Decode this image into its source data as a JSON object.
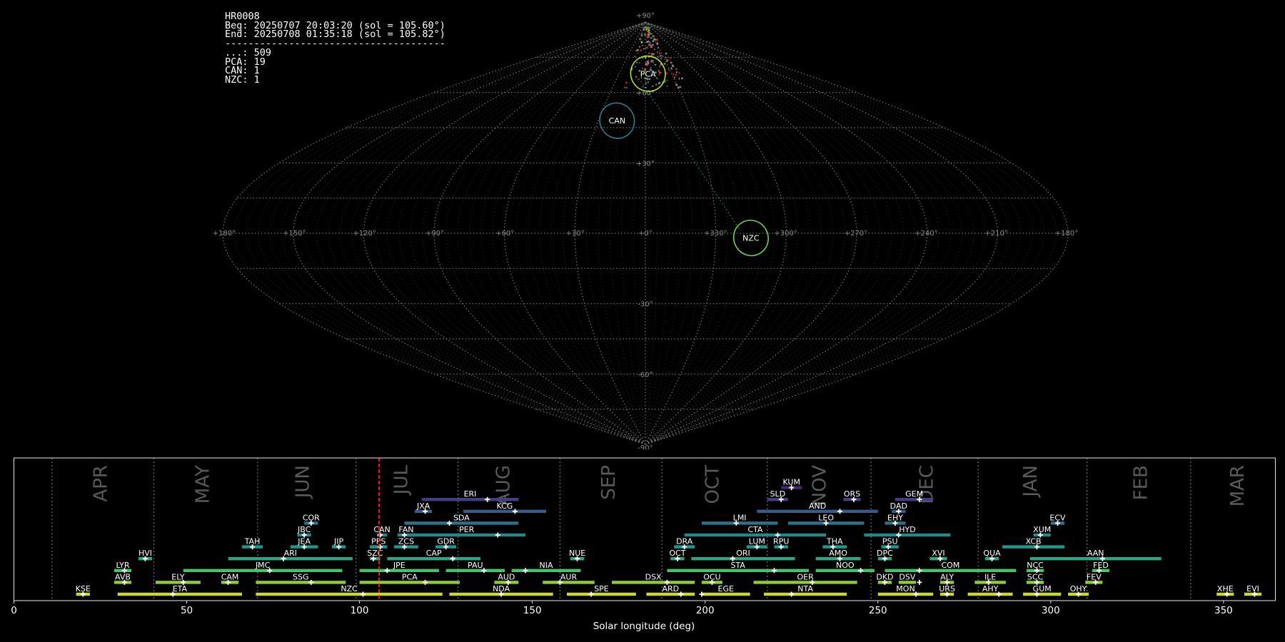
{
  "header": {
    "lines": [
      "HR0008",
      "Beg: 20250707 20:03:20 (sol = 105.60°)",
      "End: 20250708 01:35:18 (sol = 105.82°)",
      "--------------------------------------",
      "...: 509",
      "PCA: 19",
      "CAN: 1",
      "NZC: 1"
    ]
  },
  "sky_map": {
    "projection": "sinusoidal",
    "lon_tick_labels": [
      "+180°",
      "+150°",
      "+120°",
      "+90°",
      "+60°",
      "+30°",
      "+0°",
      "+330°",
      "+300°",
      "+270°",
      "+240°",
      "+210°",
      "+180°"
    ],
    "lat_tick_labels": [
      {
        "lat": 90,
        "label": "+90°"
      },
      {
        "lat": 60,
        "label": "+60°"
      },
      {
        "lat": 30,
        "label": "+30°"
      },
      {
        "lat": -30,
        "label": "-30°"
      },
      {
        "lat": -60,
        "label": "-60°"
      },
      {
        "lat": -90,
        "label": "-90°"
      }
    ],
    "radiants": [
      {
        "name": "PCA",
        "lon": -3,
        "lat": 68,
        "color": "#b5de2b"
      },
      {
        "name": "CAN",
        "lon": 18,
        "lat": 48,
        "color": "#26828e"
      },
      {
        "name": "NZC",
        "lon": -45,
        "lat": -2,
        "color": "#6ece58"
      }
    ]
  },
  "chart_data": {
    "type": "bar",
    "xlabel": "Solar longitude (deg)",
    "xlim": [
      0,
      365
    ],
    "xticks": [
      0,
      50,
      100,
      150,
      200,
      250,
      300,
      350
    ],
    "current_sol": 105.7,
    "month_boundaries": [
      11,
      40.5,
      70.5,
      99,
      128.5,
      158,
      187.5,
      218,
      248,
      279,
      310.5,
      340.5
    ],
    "months": [
      {
        "label": "APR",
        "sol": 25
      },
      {
        "label": "MAY",
        "sol": 54.5
      },
      {
        "label": "JUN",
        "sol": 83.5
      },
      {
        "label": "JUL",
        "sol": 112
      },
      {
        "label": "AUG",
        "sol": 141.5
      },
      {
        "label": "SEP",
        "sol": 172
      },
      {
        "label": "OCT",
        "sol": 202
      },
      {
        "label": "NOV",
        "sol": 233
      },
      {
        "label": "DEC",
        "sol": 264
      },
      {
        "label": "JAN",
        "sol": 294
      },
      {
        "label": "FEB",
        "sol": 326
      },
      {
        "label": "MAR",
        "sol": 354
      }
    ],
    "showers": [
      {
        "code": "KSE",
        "row": 0,
        "start": 18,
        "end": 22,
        "peak": 20
      },
      {
        "code": "ETA",
        "row": 0,
        "start": 30,
        "end": 66,
        "peak": 46
      },
      {
        "code": "NZC",
        "row": 0,
        "start": 70,
        "end": 124,
        "peak": 101
      },
      {
        "code": "NDA",
        "row": 0,
        "start": 126,
        "end": 156,
        "peak": 141
      },
      {
        "code": "SPE",
        "row": 0,
        "start": 160,
        "end": 180,
        "peak": 167
      },
      {
        "code": "ARD",
        "row": 0,
        "start": 183,
        "end": 197,
        "peak": 193
      },
      {
        "code": "EGE",
        "row": 0,
        "start": 199,
        "end": 213,
        "peak": 199
      },
      {
        "code": "NTA",
        "row": 0,
        "start": 217,
        "end": 241,
        "peak": 225
      },
      {
        "code": "MON",
        "row": 0,
        "start": 250,
        "end": 266,
        "peak": 261
      },
      {
        "code": "URS",
        "row": 0,
        "start": 268,
        "end": 272,
        "peak": 270
      },
      {
        "code": "AHY",
        "row": 0,
        "start": 276,
        "end": 289,
        "peak": 285
      },
      {
        "code": "GUM",
        "row": 0,
        "start": 292,
        "end": 303,
        "peak": 296
      },
      {
        "code": "OHY",
        "row": 0,
        "start": 305,
        "end": 311,
        "peak": 308
      },
      {
        "code": "XHE",
        "row": 0,
        "start": 348,
        "end": 353,
        "peak": 351
      },
      {
        "code": "EVI",
        "row": 0,
        "start": 356,
        "end": 361,
        "peak": 359
      },
      {
        "code": "AVB",
        "row": 1,
        "start": 29,
        "end": 34,
        "peak": 32
      },
      {
        "code": "ELY",
        "row": 1,
        "start": 41,
        "end": 54,
        "peak": 49
      },
      {
        "code": "CAM",
        "row": 1,
        "start": 60,
        "end": 65,
        "peak": 62
      },
      {
        "code": "SSG",
        "row": 1,
        "start": 70,
        "end": 96,
        "peak": 86
      },
      {
        "code": "PCA",
        "row": 1,
        "start": 100,
        "end": 129,
        "peak": 119
      },
      {
        "code": "AUD",
        "row": 1,
        "start": 139,
        "end": 146,
        "peak": 143
      },
      {
        "code": "AUR",
        "row": 1,
        "start": 153,
        "end": 168,
        "peak": 158
      },
      {
        "code": "DSX",
        "row": 1,
        "start": 173,
        "end": 197,
        "peak": 189
      },
      {
        "code": "OCU",
        "row": 1,
        "start": 199,
        "end": 205,
        "peak": 202
      },
      {
        "code": "OER",
        "row": 1,
        "start": 214,
        "end": 244,
        "peak": 231
      },
      {
        "code": "DKD",
        "row": 1,
        "start": 250,
        "end": 254,
        "peak": 252
      },
      {
        "code": "DSV",
        "row": 1,
        "start": 256,
        "end": 261,
        "peak": 262
      },
      {
        "code": "ALY",
        "row": 1,
        "start": 268,
        "end": 272,
        "peak": 270
      },
      {
        "code": "ILE",
        "row": 1,
        "start": 278,
        "end": 287,
        "peak": 282
      },
      {
        "code": "SCC",
        "row": 1,
        "start": 293,
        "end": 298,
        "peak": 296
      },
      {
        "code": "FEV",
        "row": 1,
        "start": 310,
        "end": 315,
        "peak": 313
      },
      {
        "code": "LYR",
        "row": 2,
        "start": 29,
        "end": 34,
        "peak": 32
      },
      {
        "code": "JMC",
        "row": 2,
        "start": 49,
        "end": 95,
        "peak": 74
      },
      {
        "code": "JPE",
        "row": 2,
        "start": 100,
        "end": 123,
        "peak": 108
      },
      {
        "code": "PAU",
        "row": 2,
        "start": 125,
        "end": 142,
        "peak": 136
      },
      {
        "code": "NIA",
        "row": 2,
        "start": 144,
        "end": 164,
        "peak": 148
      },
      {
        "code": "STA",
        "row": 2,
        "start": 189,
        "end": 230,
        "peak": 220
      },
      {
        "code": "NOO",
        "row": 2,
        "start": 232,
        "end": 249,
        "peak": 245
      },
      {
        "code": "COM",
        "row": 2,
        "start": 252,
        "end": 290,
        "peak": 262
      },
      {
        "code": "NCC",
        "row": 2,
        "start": 293,
        "end": 298,
        "peak": 296
      },
      {
        "code": "FED",
        "row": 2,
        "start": 312,
        "end": 317,
        "peak": 314
      },
      {
        "code": "HVI",
        "row": 3,
        "start": 36,
        "end": 40,
        "peak": 38
      },
      {
        "code": "ARI",
        "row": 3,
        "start": 62,
        "end": 98,
        "peak": 78
      },
      {
        "code": "SZC",
        "row": 3,
        "start": 103,
        "end": 106,
        "peak": 104
      },
      {
        "code": "CAP",
        "row": 3,
        "start": 108,
        "end": 135,
        "peak": 127
      },
      {
        "code": "NUE",
        "row": 3,
        "start": 161,
        "end": 165,
        "peak": 163
      },
      {
        "code": "OCT",
        "row": 3,
        "start": 190,
        "end": 194,
        "peak": 192
      },
      {
        "code": "ORI",
        "row": 3,
        "start": 196,
        "end": 226,
        "peak": 208
      },
      {
        "code": "AMO",
        "row": 3,
        "start": 232,
        "end": 245,
        "peak": 239
      },
      {
        "code": "DPC",
        "row": 3,
        "start": 250,
        "end": 254,
        "peak": 252
      },
      {
        "code": "XVI",
        "row": 3,
        "start": 265,
        "end": 270,
        "peak": 268
      },
      {
        "code": "QUA",
        "row": 3,
        "start": 281,
        "end": 285,
        "peak": 283
      },
      {
        "code": "AAN",
        "row": 3,
        "start": 294,
        "end": 332,
        "peak": 315
      },
      {
        "code": "TAH",
        "row": 4,
        "start": 66,
        "end": 72,
        "peak": 69
      },
      {
        "code": "JEA",
        "row": 4,
        "start": 80,
        "end": 88,
        "peak": 84
      },
      {
        "code": "JIP",
        "row": 4,
        "start": 92,
        "end": 96,
        "peak": 94
      },
      {
        "code": "PPS",
        "row": 4,
        "start": 103,
        "end": 108,
        "peak": 106
      },
      {
        "code": "ZCS",
        "row": 4,
        "start": 110,
        "end": 117,
        "peak": 113
      },
      {
        "code": "GDR",
        "row": 4,
        "start": 122,
        "end": 128,
        "peak": 125
      },
      {
        "code": "DRA",
        "row": 4,
        "start": 191,
        "end": 197,
        "peak": 194
      },
      {
        "code": "LUM",
        "row": 4,
        "start": 212,
        "end": 218,
        "peak": 215
      },
      {
        "code": "RPU",
        "row": 4,
        "start": 220,
        "end": 224,
        "peak": 222
      },
      {
        "code": "THA",
        "row": 4,
        "start": 234,
        "end": 241,
        "peak": 237
      },
      {
        "code": "PSU",
        "row": 4,
        "start": 251,
        "end": 256,
        "peak": 253
      },
      {
        "code": "XCB",
        "row": 4,
        "start": 286,
        "end": 304,
        "peak": 296
      },
      {
        "code": "JBC",
        "row": 5,
        "start": 82,
        "end": 86,
        "peak": 84
      },
      {
        "code": "CAN",
        "row": 5,
        "start": 105,
        "end": 108,
        "peak": 106
      },
      {
        "code": "FAN",
        "row": 5,
        "start": 111,
        "end": 116,
        "peak": 113
      },
      {
        "code": "PER",
        "row": 5,
        "start": 114,
        "end": 148,
        "peak": 140
      },
      {
        "code": "CTA",
        "row": 5,
        "start": 194,
        "end": 235,
        "peak": 221
      },
      {
        "code": "HYD",
        "row": 5,
        "start": 246,
        "end": 271,
        "peak": 256
      },
      {
        "code": "XUM",
        "row": 5,
        "start": 295,
        "end": 300,
        "peak": 297
      },
      {
        "code": "COR",
        "row": 6,
        "start": 84,
        "end": 88,
        "peak": 86
      },
      {
        "code": "SDA",
        "row": 6,
        "start": 113,
        "end": 146,
        "peak": 126
      },
      {
        "code": "LMI",
        "row": 6,
        "start": 199,
        "end": 221,
        "peak": 209
      },
      {
        "code": "LEO",
        "row": 6,
        "start": 224,
        "end": 246,
        "peak": 235
      },
      {
        "code": "EHY",
        "row": 6,
        "start": 252,
        "end": 258,
        "peak": 255
      },
      {
        "code": "ECV",
        "row": 6,
        "start": 300,
        "end": 304,
        "peak": 302
      },
      {
        "code": "JXA",
        "row": 7,
        "start": 116,
        "end": 121,
        "peak": 119
      },
      {
        "code": "KCG",
        "row": 7,
        "start": 130,
        "end": 154,
        "peak": 145
      },
      {
        "code": "AND",
        "row": 7,
        "start": 215,
        "end": 250,
        "peak": 239
      },
      {
        "code": "DAD",
        "row": 7,
        "start": 254,
        "end": 258,
        "peak": 256
      },
      {
        "code": "ERI",
        "row": 8,
        "start": 118,
        "end": 146,
        "peak": 137
      },
      {
        "code": "SLD",
        "row": 8,
        "start": 218,
        "end": 224,
        "peak": 222
      },
      {
        "code": "ORS",
        "row": 8,
        "start": 240,
        "end": 245,
        "peak": 243
      },
      {
        "code": "GEM",
        "row": 8,
        "start": 255,
        "end": 266,
        "peak": 262
      },
      {
        "code": "KUM",
        "row": 9,
        "start": 222,
        "end": 228,
        "peak": 225
      }
    ]
  }
}
